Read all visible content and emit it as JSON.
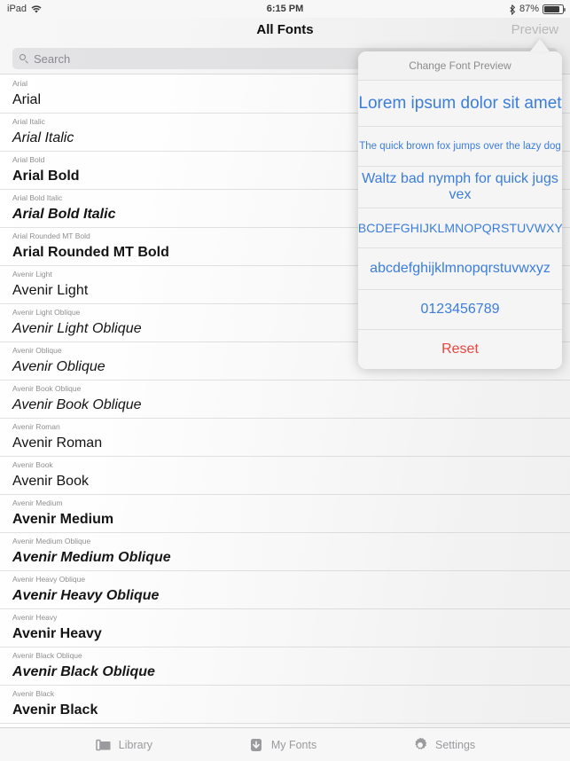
{
  "status_bar": {
    "device_label": "iPad",
    "wifi_icon": "wifi-icon",
    "time": "6:15 PM",
    "bluetooth_icon": "bluetooth-icon",
    "battery_percent": "87%",
    "battery_icon": "battery-full-icon",
    "battery_level": 87
  },
  "nav_bar": {
    "title": "All Fonts",
    "right_button": "Preview"
  },
  "search": {
    "placeholder": "Search",
    "value": "",
    "icon": "search-icon"
  },
  "font_list": [
    {
      "name": "Arial",
      "sample": "Arial",
      "style": "s-reg"
    },
    {
      "name": "Arial Italic",
      "sample": "Arial Italic",
      "style": "s-ital"
    },
    {
      "name": "Arial Bold",
      "sample": "Arial Bold",
      "style": "s-bold"
    },
    {
      "name": "Arial Bold Italic",
      "sample": "Arial Bold Italic",
      "style": "s-bolditalic"
    },
    {
      "name": "Arial Rounded MT Bold",
      "sample": "Arial Rounded MT Bold",
      "style": "s-serifrnd"
    },
    {
      "name": "Avenir Light",
      "sample": "Avenir Light",
      "style": "s-light"
    },
    {
      "name": "Avenir Light Oblique",
      "sample": "Avenir Light Oblique",
      "style": "s-lightital"
    },
    {
      "name": "Avenir Oblique",
      "sample": "Avenir Oblique",
      "style": "s-ital"
    },
    {
      "name": "Avenir Book Oblique",
      "sample": "Avenir Book Oblique",
      "style": "s-ital"
    },
    {
      "name": "Avenir Roman",
      "sample": "Avenir Roman",
      "style": "s-reg"
    },
    {
      "name": "Avenir Book",
      "sample": "Avenir Book",
      "style": "s-reg"
    },
    {
      "name": "Avenir Medium",
      "sample": "Avenir Medium",
      "style": "s-med"
    },
    {
      "name": "Avenir Medium Oblique",
      "sample": "Avenir Medium Oblique",
      "style": "s-medital"
    },
    {
      "name": "Avenir Heavy Oblique",
      "sample": "Avenir Heavy Oblique",
      "style": "s-heavyital"
    },
    {
      "name": "Avenir Heavy",
      "sample": "Avenir Heavy",
      "style": "s-heavy"
    },
    {
      "name": "Avenir Black Oblique",
      "sample": "Avenir Black Oblique",
      "style": "s-heavyital"
    },
    {
      "name": "Avenir Black",
      "sample": "Avenir Black",
      "style": "s-heavy"
    }
  ],
  "popover": {
    "header": "Change Font Preview",
    "options": [
      {
        "label": "Lorem ipsum dolor sit amet",
        "cls": "pi-lorem"
      },
      {
        "label": "The quick brown fox jumps over the lazy dog",
        "cls": "pi-quick"
      },
      {
        "label": "Waltz bad nymph for quick jugs vex",
        "cls": "pi-waltz"
      },
      {
        "label": "ABCDEFGHIJKLMNOPQRSTUVWXYZ",
        "cls": "pi-upper"
      },
      {
        "label": "abcdefghijklmnopqrstuvwxyz",
        "cls": "pi-lower"
      },
      {
        "label": "0123456789",
        "cls": "pi-digits"
      },
      {
        "label": "Reset",
        "cls": "pi-reset"
      }
    ],
    "accent_color": "#3b7ddd",
    "destructive_color": "#e8453c"
  },
  "tab_bar": {
    "tabs": [
      {
        "label": "Library",
        "icon": "library-icon"
      },
      {
        "label": "My Fonts",
        "icon": "download-icon"
      },
      {
        "label": "Settings",
        "icon": "gear-icon"
      }
    ]
  }
}
